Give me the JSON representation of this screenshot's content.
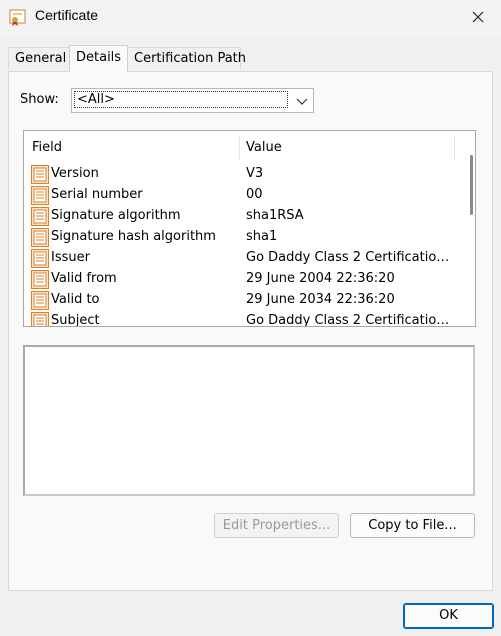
{
  "window": {
    "title": "Certificate"
  },
  "tabs": [
    {
      "label": "General"
    },
    {
      "label": "Details"
    },
    {
      "label": "Certification Path"
    }
  ],
  "show": {
    "label": "Show:",
    "selected": "<All>"
  },
  "list": {
    "headers": {
      "field": "Field",
      "value": "Value"
    },
    "rows": [
      {
        "field": "Version",
        "value": "V3"
      },
      {
        "field": "Serial number",
        "value": "00"
      },
      {
        "field": "Signature algorithm",
        "value": "sha1RSA"
      },
      {
        "field": "Signature hash algorithm",
        "value": "sha1"
      },
      {
        "field": "Issuer",
        "value": "Go Daddy Class 2 Certification..."
      },
      {
        "field": "Valid from",
        "value": "29 June 2004 22:36:20"
      },
      {
        "field": "Valid to",
        "value": "29 June 2034 22:36:20"
      },
      {
        "field": "Subject",
        "value": "Go Daddy Class 2 Certification..."
      }
    ]
  },
  "buttons": {
    "edit_properties": "Edit Properties...",
    "copy_to_file": "Copy to File...",
    "ok": "OK"
  },
  "icons": {
    "title": "certificate-icon",
    "close": "close-icon",
    "dropdown": "chevron-down-icon",
    "row": "certificate-field-icon"
  },
  "colors": {
    "accent": "#0067c0",
    "icon_orange": "#d9822b"
  }
}
